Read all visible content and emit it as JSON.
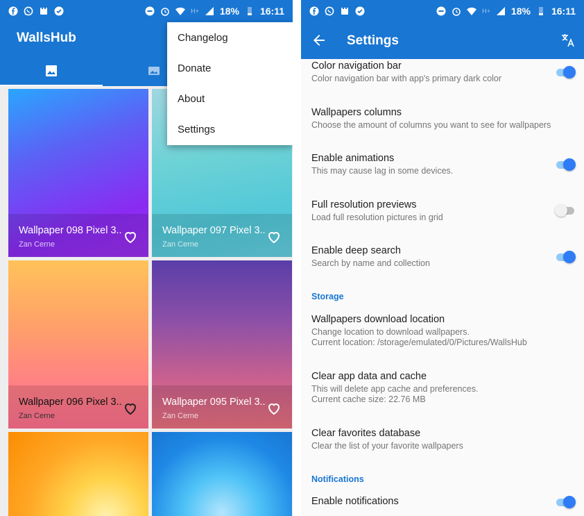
{
  "left_screen": {
    "status_bar": {
      "icons_left": [
        "facebook-icon",
        "whatsapp-icon",
        "app-icon",
        "check-icon"
      ],
      "icons_right": [
        "dnd-icon",
        "alarm-icon",
        "wifi-icon",
        "signal-icon",
        "battery-icon"
      ],
      "network": "H+",
      "battery": "18%",
      "time": "16:11"
    },
    "app_title": "WallsHub",
    "tabs": [
      {
        "icon": "wallpapers-icon",
        "selected": true
      },
      {
        "icon": "collections-icon",
        "selected": false
      }
    ],
    "overflow_menu": {
      "items": [
        "Changelog",
        "Donate",
        "About",
        "Settings"
      ]
    },
    "wallpapers": [
      {
        "title": "Wallpaper 098 Pixel 3...",
        "author": "Zan Cerne"
      },
      {
        "title": "Wallpaper 097 Pixel 3...",
        "author": "Zan Cerne"
      },
      {
        "title": "Wallpaper 096 Pixel 3...",
        "author": "Zan Cerne"
      },
      {
        "title": "Wallpaper 095 Pixel 3...",
        "author": "Zan Cerne"
      }
    ]
  },
  "right_screen": {
    "status_bar": {
      "icons_left": [
        "facebook-icon",
        "whatsapp-icon",
        "app-icon",
        "check-icon"
      ],
      "icons_right": [
        "dnd-icon",
        "alarm-icon",
        "wifi-icon",
        "signal-icon",
        "battery-icon"
      ],
      "network": "H+",
      "battery": "18%",
      "time": "16:11"
    },
    "title": "Settings",
    "settings": [
      {
        "title": "Color navigation bar",
        "summary": "Color navigation bar with app's primary dark color",
        "toggle": true
      },
      {
        "title": "Wallpapers columns",
        "summary": "Choose the amount of columns you want to see for wallpapers"
      },
      {
        "title": "Enable animations",
        "summary": "This may cause lag in some devices.",
        "toggle": true
      },
      {
        "title": "Full resolution previews",
        "summary": "Load full resolution pictures in grid",
        "toggle": false
      },
      {
        "title": "Enable deep search",
        "summary": "Search by name and collection",
        "toggle": true
      }
    ],
    "storage": {
      "category": "Storage",
      "items": [
        {
          "title": "Wallpapers download location",
          "summary_line1": "Change location to download wallpapers.",
          "summary_line2": "Current location: /storage/emulated/0/Pictures/WallsHub"
        },
        {
          "title": "Clear app data and cache",
          "summary_line1": "This will delete app cache and preferences.",
          "summary_line2": "Current cache size: 22.76 MB"
        },
        {
          "title": "Clear favorites database",
          "summary_line1": "Clear the list of your favorite wallpapers"
        }
      ]
    },
    "notifications": {
      "category": "Notifications",
      "items": [
        {
          "title": "Enable notifications",
          "toggle": true
        }
      ]
    }
  },
  "colors": {
    "primary": "#1976d2",
    "accent": "#2e7cf6",
    "switch_track_on": "#90caf9",
    "category_text": "#1976d2"
  }
}
